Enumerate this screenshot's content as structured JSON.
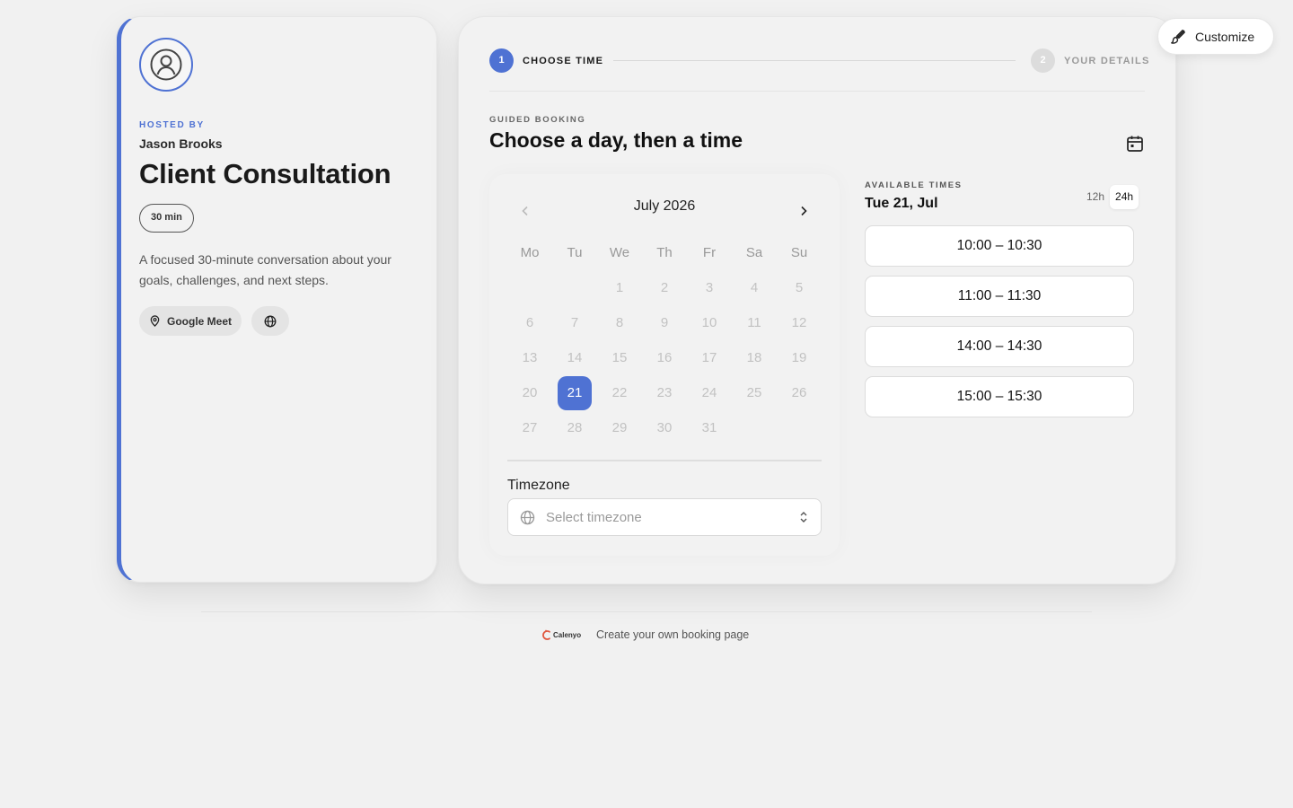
{
  "host": {
    "hosted_label": "HOSTED BY",
    "name": "Jason Brooks"
  },
  "event": {
    "title": "Client Consultation",
    "duration": "30 min",
    "description": "A focused 30-minute conversation about your goals, challenges, and next steps.",
    "location": "Google Meet"
  },
  "steps": [
    {
      "number": "1",
      "label": "CHOOSE TIME",
      "active": true
    },
    {
      "number": "2",
      "label": "YOUR DETAILS",
      "active": false
    }
  ],
  "booking": {
    "kicker": "GUIDED BOOKING",
    "heading": "Choose a day, then a time"
  },
  "calendar": {
    "month": "July 2026",
    "weekdays": [
      "Mo",
      "Tu",
      "We",
      "Th",
      "Fr",
      "Sa",
      "Su"
    ],
    "first_weekday_index": 2,
    "days_in_month": 31,
    "selected_day": 21
  },
  "timezone": {
    "label": "Timezone",
    "placeholder": "Select timezone"
  },
  "times": {
    "label": "AVAILABLE TIMES",
    "date": "Tue 21, Jul",
    "format_options": [
      "12h",
      "24h"
    ],
    "format_selected": "24h",
    "slots": [
      "10:00 – 10:30",
      "11:00 – 11:30",
      "14:00 – 14:30",
      "15:00 – 15:30"
    ]
  },
  "customize": {
    "label": "Customize"
  },
  "footer": {
    "brand": "Calenyo",
    "cta": "Create your own booking page"
  },
  "colors": {
    "accent": "#4f72d3",
    "background": "#f1f1f1"
  }
}
